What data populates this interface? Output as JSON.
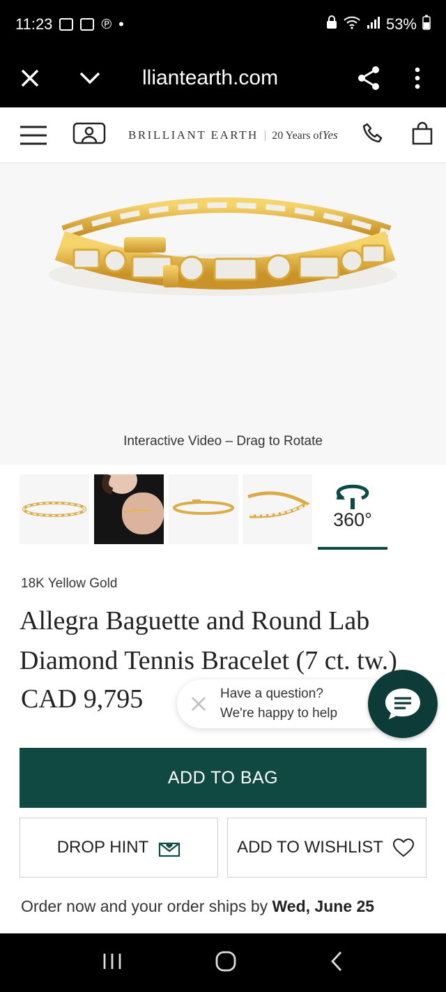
{
  "status_bar": {
    "time": "11:23",
    "battery": "53%"
  },
  "browser": {
    "url": "lliantearth.com"
  },
  "header": {
    "brand": "BRILLIANT EARTH",
    "tagline_years": "20 Years of",
    "tagline_yes": "Yes"
  },
  "hero": {
    "caption": "Interactive Video – Drag to Rotate"
  },
  "thumbnails": {
    "view_360_label": "360°"
  },
  "product": {
    "metal": "18K Yellow Gold",
    "title": "Allegra Baguette and Round Lab Diamond Tennis Bracelet (7 ct. tw.)",
    "price": "CAD 9,795"
  },
  "chat": {
    "line1": "Have a question?",
    "line2": "We're happy to help"
  },
  "actions": {
    "add_to_bag": "ADD TO BAG",
    "drop_hint": "DROP HINT",
    "add_to_wishlist": "ADD TO WISHLIST"
  },
  "shipping": {
    "prefix": "Order now and your order ships by",
    "date": "Wed, June 25"
  },
  "colors": {
    "accent": "#0f4942",
    "gold": "#e2b23a"
  }
}
